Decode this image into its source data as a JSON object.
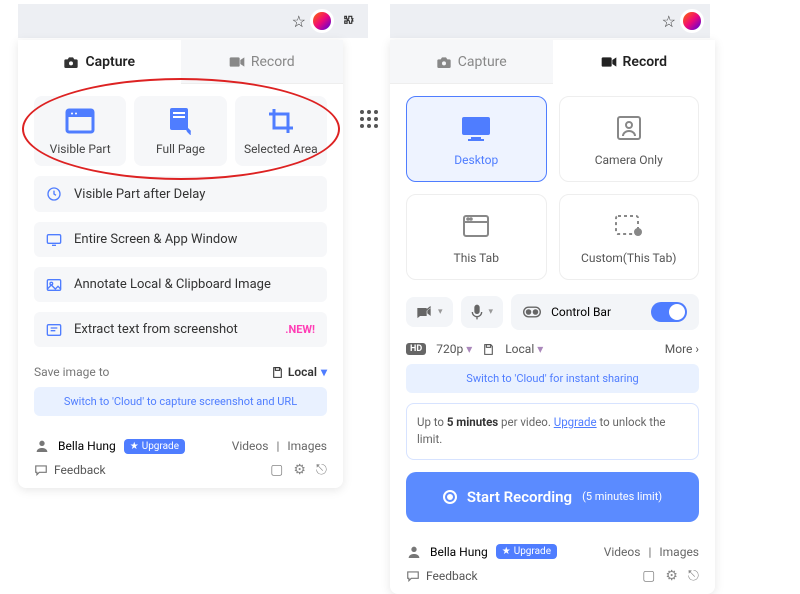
{
  "left": {
    "addr": {
      "star": "☆"
    },
    "tabs": {
      "capture": "Capture",
      "record": "Record"
    },
    "cards": [
      {
        "label": "Visible Part"
      },
      {
        "label": "Full Page"
      },
      {
        "label": "Selected Area"
      }
    ],
    "rows": [
      {
        "label": "Visible Part after Delay"
      },
      {
        "label": "Entire Screen & App Window"
      },
      {
        "label": "Annotate Local & Clipboard Image"
      },
      {
        "label": "Extract text from screenshot",
        "new": ".NEW!"
      }
    ],
    "save_to": "Save image to",
    "local": "Local",
    "banner": "Switch to 'Cloud' to capture screenshot and URL",
    "user": "Bella Hung",
    "upgrade": "Upgrade",
    "links": {
      "videos": "Videos",
      "images": "Images"
    },
    "feedback": "Feedback"
  },
  "right": {
    "addr": {
      "star": "☆"
    },
    "tabs": {
      "capture": "Capture",
      "record": "Record"
    },
    "cards": [
      {
        "label": "Desktop"
      },
      {
        "label": "Camera Only"
      },
      {
        "label": "This Tab"
      },
      {
        "label": "Custom(This Tab)"
      }
    ],
    "control_bar": "Control Bar",
    "quality": "720p",
    "storage": "Local",
    "more": "More",
    "banner": "Switch to 'Cloud' for instant sharing",
    "info_pre": "Up to ",
    "info_b": "5 minutes",
    "info_mid": " per video. ",
    "info_link": "Upgrade",
    "info_post": " to unlock the limit.",
    "start": "Start Recording",
    "start_limit": "(5 minutes limit)",
    "user": "Bella Hung",
    "upgrade": "Upgrade",
    "links": {
      "videos": "Videos",
      "images": "Images"
    },
    "feedback": "Feedback"
  }
}
